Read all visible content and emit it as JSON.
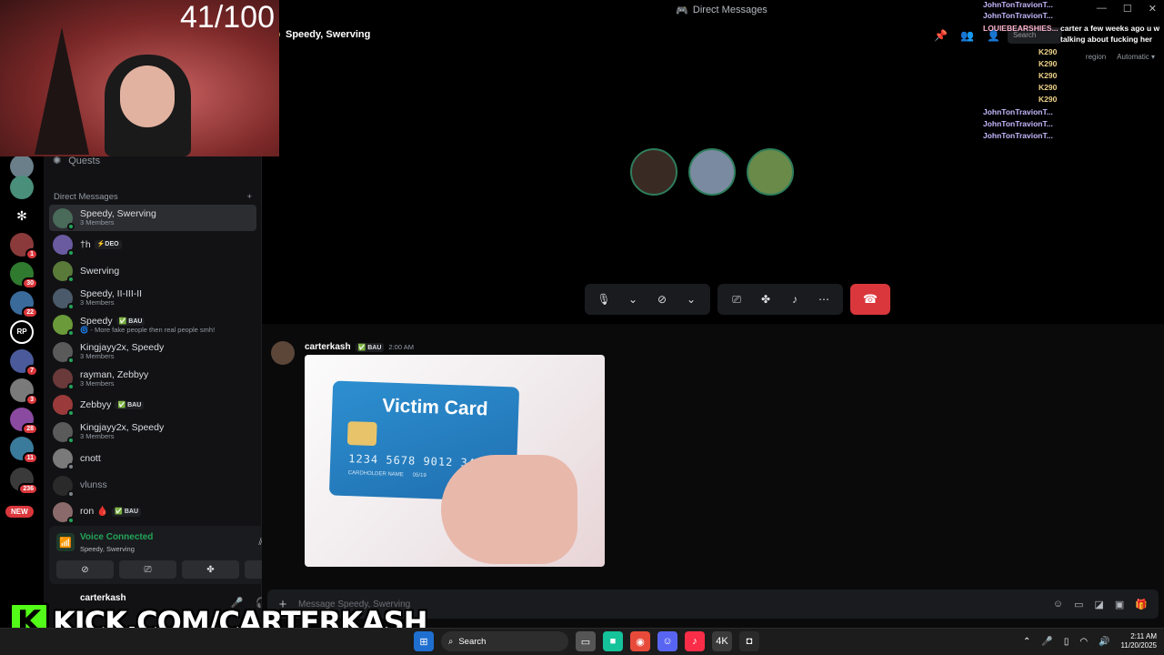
{
  "window": {
    "title": "Direct Messages"
  },
  "stream": {
    "counter": "41/100",
    "kick_url": "KICK.COM/CARTERKASH",
    "kick_logo": "K"
  },
  "rail": {
    "badges": [
      "1",
      "30",
      "22",
      "7",
      "3",
      "28",
      "11",
      "236"
    ],
    "new_badge": "NEW",
    "rp_label": "RP"
  },
  "sidebar": {
    "quests_label": "Quests",
    "dm_header": "Direct Messages",
    "add_label": "+",
    "dms": [
      {
        "name": "Speedy, Swerving",
        "sub": "3 Members",
        "active": true
      },
      {
        "name": "†h",
        "tag": "⚡DEO"
      },
      {
        "name": "Swerving"
      },
      {
        "name": "Speedy, II-III-II",
        "sub": "3 Members"
      },
      {
        "name": "Speedy",
        "tag": "✅ BAU",
        "sub": "🌀 - More fake people then real people smh!"
      },
      {
        "name": "Kingjayy2x, Speedy",
        "sub": "3 Members"
      },
      {
        "name": "rayman, Zebbyy",
        "sub": "3 Members"
      },
      {
        "name": "Zebbyy",
        "tag": "✅ BAU"
      },
      {
        "name": "Kingjayy2x, Speedy",
        "sub": "3 Members"
      },
      {
        "name": "cnott"
      },
      {
        "name": "vlunss",
        "muted": true
      },
      {
        "name": "ron 🩸",
        "tag": "✅ BAU"
      }
    ]
  },
  "voice": {
    "status": "Voice Connected",
    "channel": "Speedy, Swerving"
  },
  "user": {
    "name": "carterkash"
  },
  "call": {
    "title": "Speedy, Swerving",
    "search_placeholder": "Search",
    "region_label": "region",
    "region_value": "Automatic"
  },
  "message": {
    "author": "carterkash",
    "tag": "✅ BAU",
    "time": "2:00 AM",
    "card_title": "Victim Card",
    "card_number": "1234 5678 9012 3456",
    "card_holder": "CARDHOLDER NAME",
    "card_expiry": "05/19"
  },
  "composer": {
    "placeholder": "Message Speedy, Swerving"
  },
  "chat_overlay": {
    "names": [
      "JohnTonTravionT...",
      "JohnTonTravionT...",
      "LOUIEBEARSHIES...",
      "K290",
      "K290",
      "K290",
      "K290",
      "K290",
      "JohnTonTravionT...",
      "JohnTonTravionT...",
      "JohnTonTravionT..."
    ],
    "message_line1": "carter a few weeks ago u w",
    "message_line2": "talking about fucking her"
  },
  "taskbar": {
    "search_label": "Search",
    "time": "2:11 AM",
    "date": "11/20/2025"
  }
}
